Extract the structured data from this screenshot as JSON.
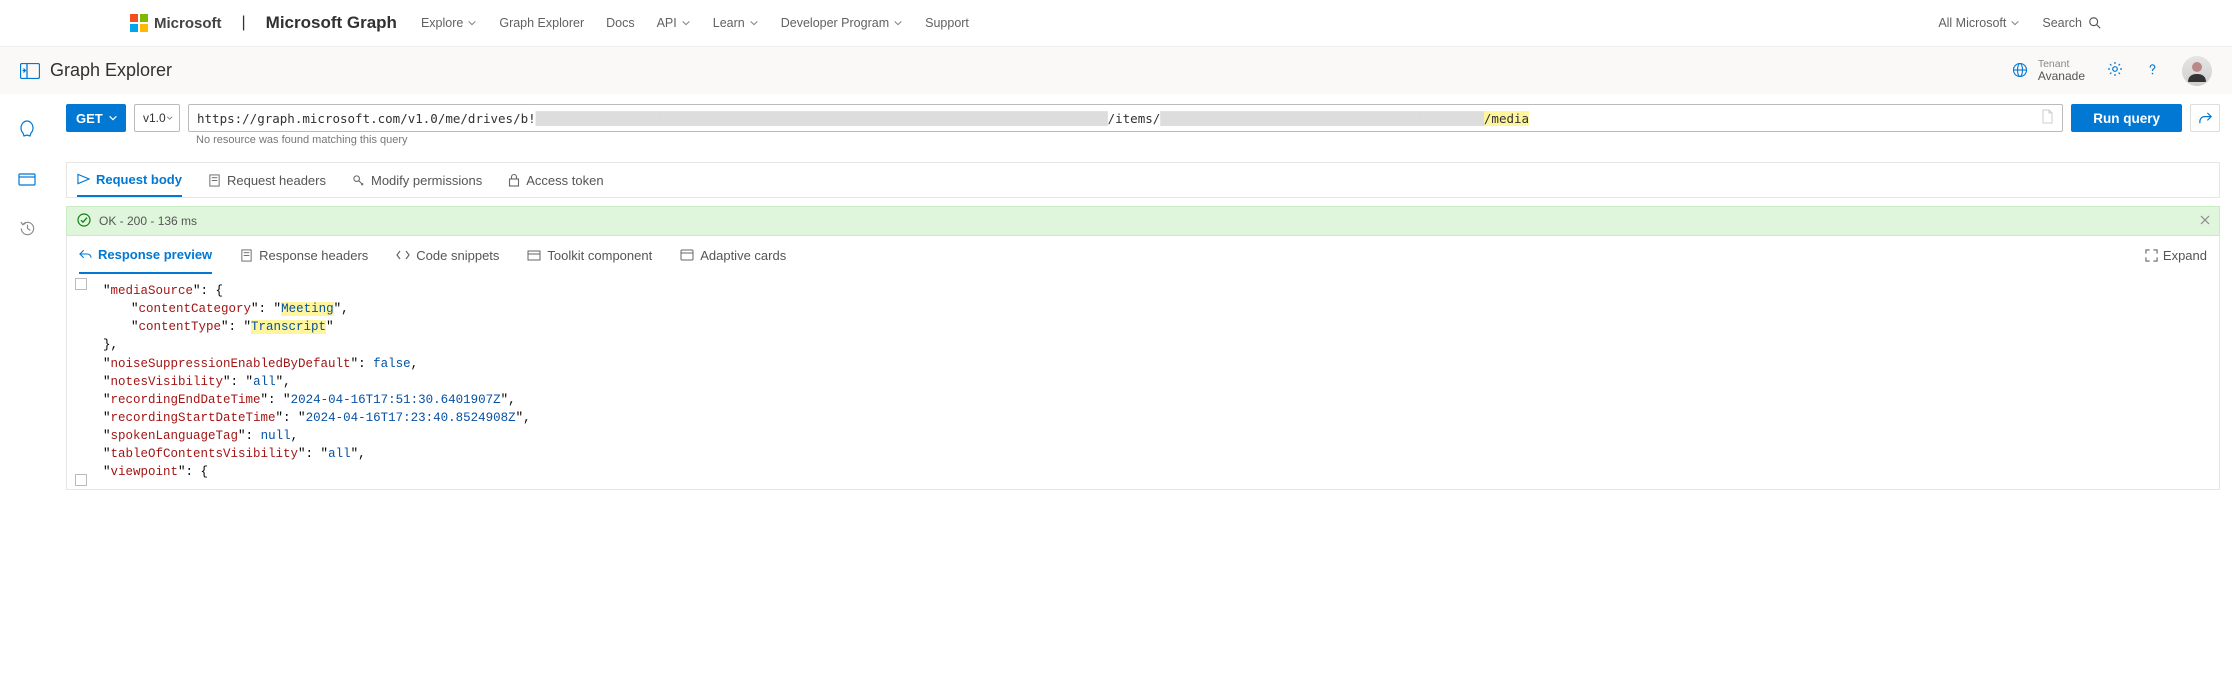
{
  "top_nav": {
    "brand_left": "Microsoft",
    "brand_right": "Microsoft Graph",
    "links": [
      "Explore",
      "Graph Explorer",
      "Docs",
      "API",
      "Learn",
      "Developer Program",
      "Support"
    ],
    "link_has_chevron": [
      true,
      false,
      false,
      true,
      true,
      true,
      false
    ],
    "right": {
      "all_ms": "All Microsoft",
      "search": "Search"
    }
  },
  "app_header": {
    "title": "Graph Explorer",
    "tenant_label": "Tenant",
    "tenant_value": "Avanade"
  },
  "query": {
    "method": "GET",
    "version": "v1.0",
    "url_prefix": "https://graph.microsoft.com/v1.0/me/drives/b!",
    "url_mid": "/items/",
    "url_highlight": "/media",
    "msg": "No resource was found matching this query",
    "run": "Run query"
  },
  "request_tabs": [
    "Request body",
    "Request headers",
    "Modify permissions",
    "Access token"
  ],
  "status": {
    "text": "OK - 200 - 136 ms"
  },
  "response_tabs": [
    "Response preview",
    "Response headers",
    "Code snippets",
    "Toolkit component",
    "Adaptive cards"
  ],
  "expand": "Expand",
  "json": {
    "mediaSource_key": "mediaSource",
    "contentCategory_key": "contentCategory",
    "contentCategory_val": "Meeting",
    "contentType_key": "contentType",
    "contentType_val": "Transcript",
    "noiseSuppression_key": "noiseSuppressionEnabledByDefault",
    "noiseSuppression_val": "false",
    "notesVisibility_key": "notesVisibility",
    "notesVisibility_val": "all",
    "recordingEnd_key": "recordingEndDateTime",
    "recordingEnd_val": "2024-04-16T17:51:30.6401907Z",
    "recordingStart_key": "recordingStartDateTime",
    "recordingStart_val": "2024-04-16T17:23:40.8524908Z",
    "spokenLang_key": "spokenLanguageTag",
    "spokenLang_val": "null",
    "toc_key": "tableOfContentsVisibility",
    "toc_val": "all",
    "viewpoint_key": "viewpoint"
  }
}
